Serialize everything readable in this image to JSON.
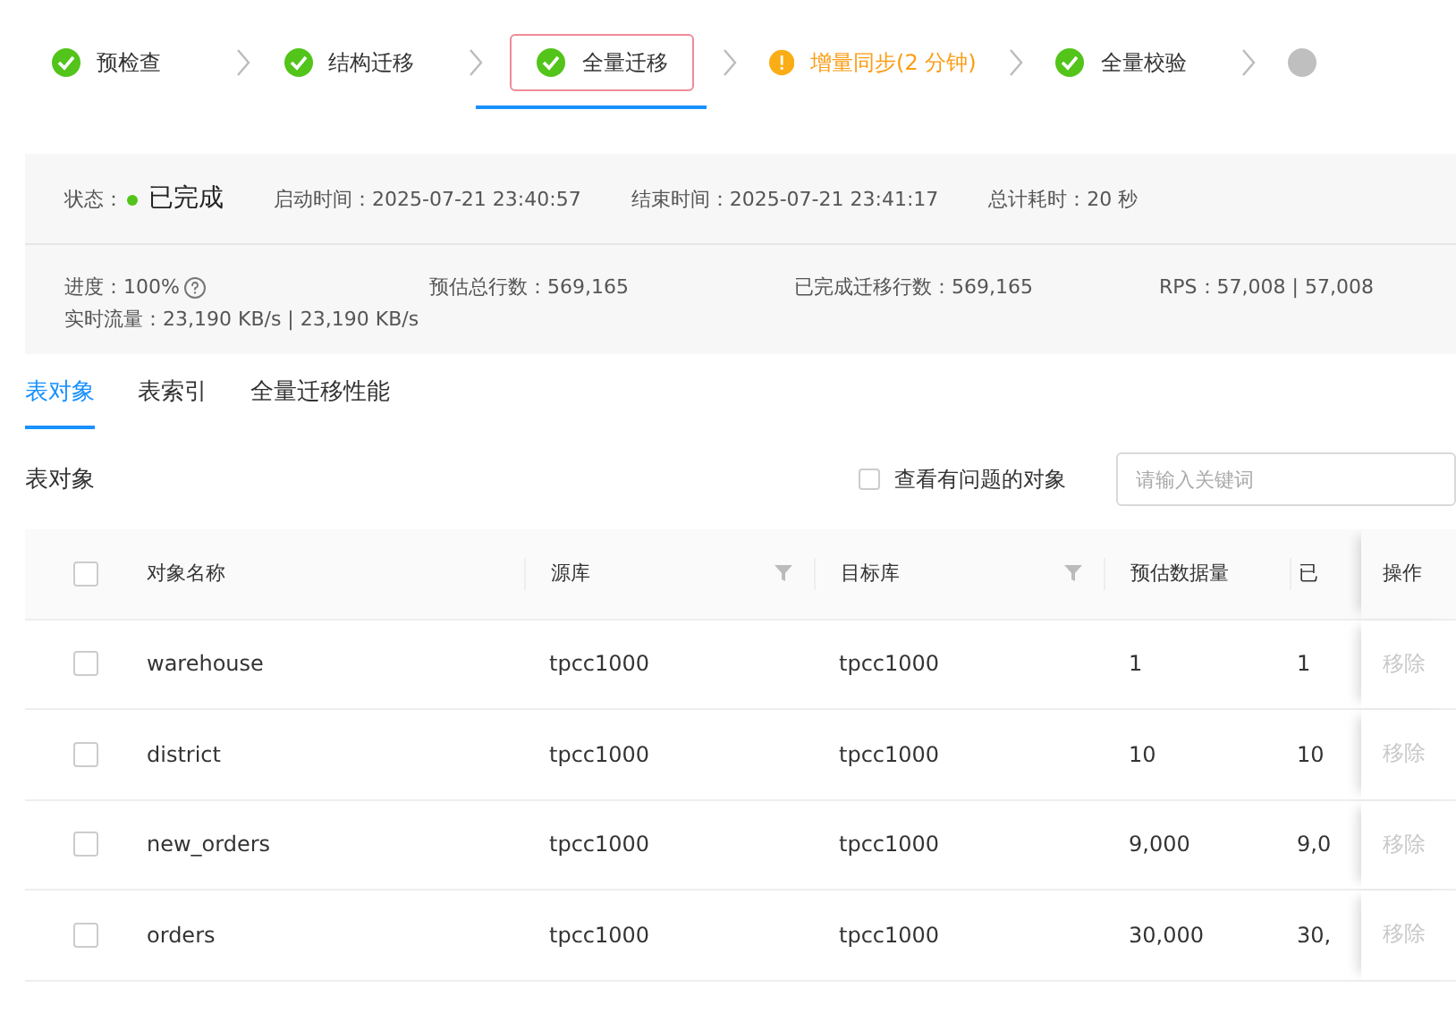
{
  "steps": [
    {
      "label": "预检查",
      "kind": "done",
      "selected": false
    },
    {
      "label": "结构迁移",
      "kind": "done",
      "selected": false
    },
    {
      "label": "全量迁移",
      "kind": "done",
      "selected": true
    },
    {
      "label": "增量同步(2 分钟)",
      "kind": "warning",
      "selected": false
    },
    {
      "label": "全量校验",
      "kind": "done",
      "selected": false
    },
    {
      "kind": "pending",
      "selected": false
    }
  ],
  "summary": {
    "status": {
      "label": "状态：",
      "value": "已完成",
      "color": "#52c41a"
    },
    "row1": [
      "启动时间：2025-07-21 23:40:57",
      "结束时间：2025-07-21 23:41:17",
      "总计耗时：20 秒"
    ],
    "progress": "进度：100%",
    "row2": [
      "预估总行数：569,165",
      "已完成迁移行数：569,165",
      "RPS：57,008 | 57,008"
    ],
    "flow": "实时流量：23,190 KB/s | 23,190 KB/s"
  },
  "tabs": [
    {
      "label": "表对象",
      "selected": true
    },
    {
      "label": "表索引",
      "selected": false
    },
    {
      "label": "全量迁移性能",
      "selected": false
    }
  ],
  "section_title": "表对象",
  "problem_filter": {
    "label": "查看有问题的对象",
    "checked": false
  },
  "search": {
    "placeholder": "请输入关键词"
  },
  "table": {
    "all_checked": false,
    "columns": [
      {
        "label": "对象名称",
        "filter": false
      },
      {
        "label": "源库",
        "filter": true
      },
      {
        "label": "目标库",
        "filter": true
      },
      {
        "label": "预估数据量",
        "filter": false
      },
      {
        "label": "已",
        "filter": false
      },
      {
        "label": "操作",
        "filter": false
      }
    ],
    "rows": [
      {
        "checked": false,
        "cells": [
          "warehouse",
          "tpcc1000",
          "tpcc1000",
          "1",
          "1"
        ],
        "action": "移除",
        "disabled": true
      },
      {
        "checked": false,
        "cells": [
          "district",
          "tpcc1000",
          "tpcc1000",
          "10",
          "10"
        ],
        "action": "移除",
        "disabled": true
      },
      {
        "checked": false,
        "cells": [
          "new_orders",
          "tpcc1000",
          "tpcc1000",
          "9,000",
          "9,0"
        ],
        "action": "移除",
        "disabled": true
      },
      {
        "checked": false,
        "cells": [
          "orders",
          "tpcc1000",
          "tpcc1000",
          "30,000",
          "30,"
        ],
        "action": "移除",
        "disabled": true
      }
    ]
  }
}
